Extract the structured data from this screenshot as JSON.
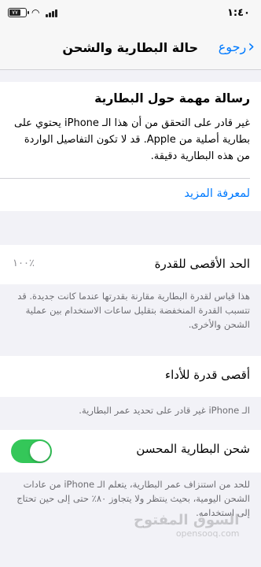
{
  "status_bar": {
    "time": "١:٤٠",
    "battery_level": "٧٧",
    "battery_icon": "battery-icon",
    "wifi_icon": "wifi-icon",
    "signal_icon": "cellular-signal-icon"
  },
  "nav": {
    "back_label": "رجوع",
    "back_icon": "chevron-right-icon",
    "title": "حالة البطارية والشحن"
  },
  "message": {
    "heading": "رسالة مهمة حول البطارية",
    "body": "غير قادر على التحقق من أن هذا الـ iPhone يحتوي على بطارية أصلية من Apple. قد لا تكون التفاصيل الواردة من هذه البطارية دقيقة.",
    "learn_more": "لمعرفة المزيد"
  },
  "maximum_capacity": {
    "label": "الحد الأقصى للقدرة",
    "value": "٪١٠٠",
    "note": "هذا قياس لقدرة البطارية مقارنة بقدرتها عندما كانت جديدة. قد تتسبب القدرة المنخفضة بتقليل ساعات الاستخدام بين عملية الشحن والأخرى."
  },
  "peak_performance": {
    "label": "أقصى قدرة للأداء",
    "note": "الـ iPhone غير قادر على تحديد عمر البطارية."
  },
  "optimized_charging": {
    "label": "شحن البطارية المحسن",
    "enabled": true,
    "note": "للحد من استنزاف عمر البطارية، يتعلم الـ iPhone من عادات الشحن اليومية، بحيث ينتظر ولا يتجاوز ٨٠٪ حتى إلى حين تحتاج إلى استخدامه."
  },
  "watermark": {
    "arabic": "السوق المفتوح",
    "latin": "opensooq.com"
  },
  "colors": {
    "accent": "#007aff",
    "toggle_on": "#34c759",
    "background": "#f2f2f7"
  }
}
